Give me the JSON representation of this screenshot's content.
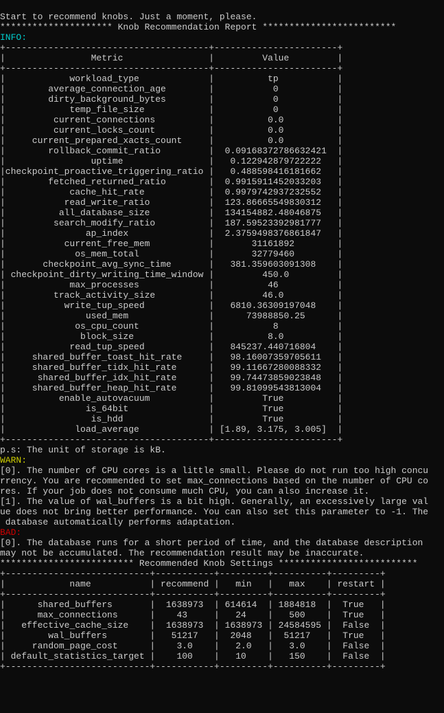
{
  "intro_line": "Start to recommend knobs. Just a moment, please.",
  "report_banner": "********************* Knob Recommendation Report *************************",
  "info_label": "INFO:",
  "table1_border": "+--------------------------------------+-----------------------+",
  "table1_header": "|                Metric                |         Value         |",
  "metrics": [
    [
      "workload_type",
      "tp"
    ],
    [
      "average_connection_age",
      "0"
    ],
    [
      "dirty_background_bytes",
      "0"
    ],
    [
      "temp_file_size",
      "0"
    ],
    [
      "current_connections",
      "0.0"
    ],
    [
      "current_locks_count",
      "0.0"
    ],
    [
      "current_prepared_xacts_count",
      "0.0"
    ],
    [
      "rollback_commit_ratio",
      "0.09168372786632421"
    ],
    [
      "uptime",
      "0.122942879722222"
    ],
    [
      "checkpoint_proactive_triggering_ratio",
      "0.488598416181662"
    ],
    [
      "fetched_returned_ratio",
      "0.9915911452033203"
    ],
    [
      "cache_hit_rate",
      "0.9979742937232552"
    ],
    [
      "read_write_ratio",
      "123.86665549830312"
    ],
    [
      "all_database_size",
      "134154882.48046875"
    ],
    [
      "search_modify_ratio",
      "187.59523392981777"
    ],
    [
      "ap_index",
      "2.3759498376861847"
    ],
    [
      "current_free_mem",
      "31161892"
    ],
    [
      "os_mem_total",
      "32779460"
    ],
    [
      "checkpoint_avg_sync_time",
      "381.359603091308"
    ],
    [
      "checkpoint_dirty_writing_time_window",
      "450.0"
    ],
    [
      "max_processes",
      "46"
    ],
    [
      "track_activity_size",
      "46.0"
    ],
    [
      "write_tup_speed",
      "6810.36309197048"
    ],
    [
      "used_mem",
      "73988850.25"
    ],
    [
      "os_cpu_count",
      "8"
    ],
    [
      "block_size",
      "8.0"
    ],
    [
      "read_tup_speed",
      "845237.440716804"
    ],
    [
      "shared_buffer_toast_hit_rate",
      "98.16007359705611"
    ],
    [
      "shared_buffer_tidx_hit_rate",
      "99.11667280088332"
    ],
    [
      "shared_buffer_idx_hit_rate",
      "99.74473859023848"
    ],
    [
      "shared_buffer_heap_hit_rate",
      "99.81099543813004"
    ],
    [
      "enable_autovacuum",
      "True"
    ],
    [
      "is_64bit",
      "True"
    ],
    [
      "is_hdd",
      "True"
    ],
    [
      "load_average",
      "[1.89, 3.175, 3.005]"
    ]
  ],
  "ps_line": "p.s: The unit of storage is kB.",
  "warn_label": "WARN:",
  "warn_items": [
    "[0]. The number of CPU cores is a little small. Please do not run too high concu\nrrency. You are recommended to set max_connections based on the number of CPU co\nres. If your job does not consume much CPU, you can also increase it.",
    "[1]. The value of wal_buffers is a bit high. Generally, an excessively large val\nue does not bring better performance. You can also set this parameter to -1. The\n database automatically performs adaptation."
  ],
  "bad_label": "BAD:",
  "bad_items": [
    "[0]. The database runs for a short period of time, and the database description \nmay not be accumulated. The recommendation result may be inaccurate."
  ],
  "settings_banner": "************************* Recommended Knob Settings **************************",
  "table2_border": "+---------------------------+-----------+---------+----------+---------+",
  "table2_header": "|            name           | recommend |   min   |   max    | restart |",
  "knobs": [
    [
      "shared_buffers",
      "1638973",
      "614614",
      "1884818",
      "True"
    ],
    [
      "max_connections",
      "43",
      "24",
      "500",
      "True"
    ],
    [
      "effective_cache_size",
      "1638973",
      "1638973",
      "24584595",
      "False"
    ],
    [
      "wal_buffers",
      "51217",
      "2048",
      "51217",
      "True"
    ],
    [
      "random_page_cost",
      "3.0",
      "2.0",
      "3.0",
      "False"
    ],
    [
      "default_statistics_target",
      "100",
      "10",
      "150",
      "False"
    ]
  ],
  "chart_data": {
    "type": "table",
    "tables": [
      {
        "title": "Knob Recommendation Report",
        "columns": [
          "Metric",
          "Value"
        ]
      },
      {
        "title": "Recommended Knob Settings",
        "columns": [
          "name",
          "recommend",
          "min",
          "max",
          "restart"
        ]
      }
    ]
  }
}
